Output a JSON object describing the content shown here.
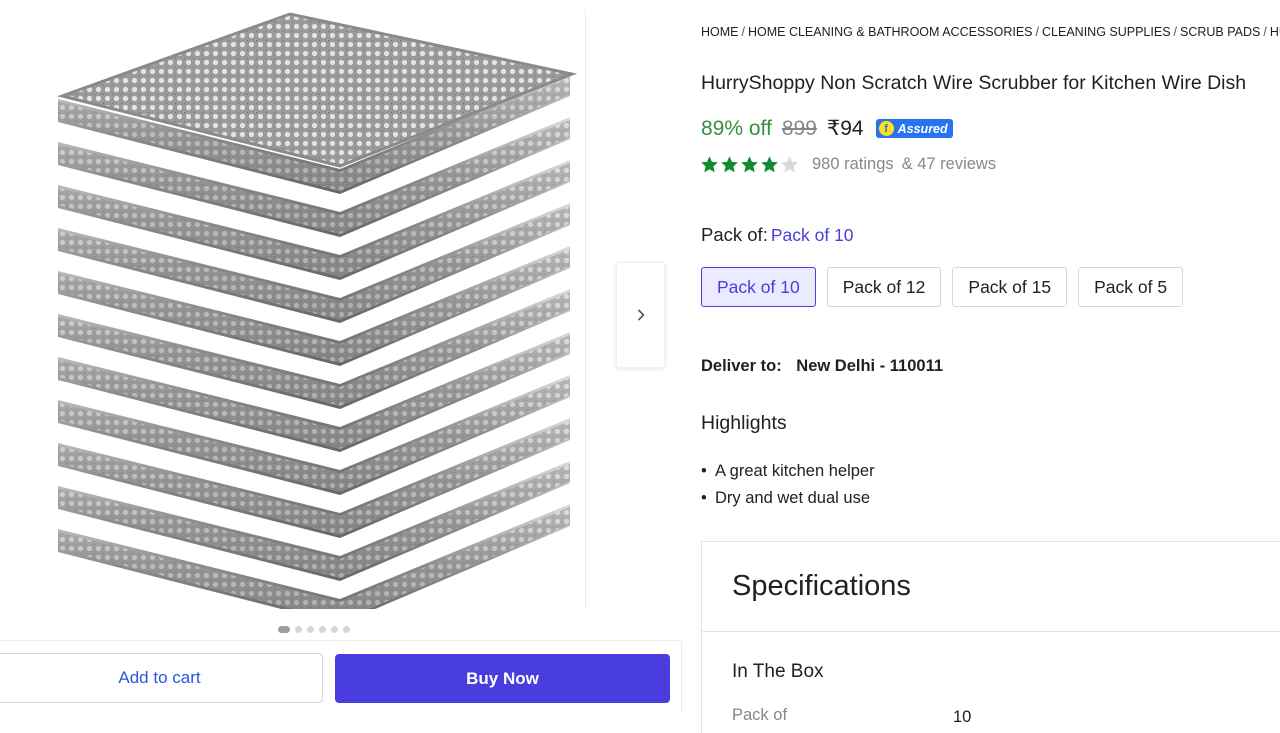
{
  "breadcrumb": [
    "HOME",
    "HOME CLEANING & BATHROOM ACCESSORIES",
    "CLEANING SUPPLIES",
    "SCRUB PADS",
    "HU"
  ],
  "product": {
    "title": "HurryShoppy Non Scratch Wire Scrubber for Kitchen Wire Dish",
    "discount": "89% off",
    "mrp": "899",
    "price": "₹94",
    "assured_label": "Assured",
    "rating_value": 4,
    "ratings_text": "980 ratings",
    "reviews_text": "& 47 reviews"
  },
  "pack": {
    "label": "Pack of:",
    "selected": "Pack of 10",
    "options": [
      "Pack of 10",
      "Pack of 12",
      "Pack of 15",
      "Pack of 5"
    ]
  },
  "delivery": {
    "label": "Deliver to:",
    "location": "New Delhi - 110011"
  },
  "highlights": {
    "title": "Highlights",
    "items": [
      "A great kitchen helper",
      "Dry and wet dual use"
    ]
  },
  "specifications": {
    "title": "Specifications",
    "section": "In The Box",
    "rows": [
      {
        "key": "Pack of",
        "value": "10"
      }
    ]
  },
  "gallery": {
    "image_count": 6,
    "active_index": 0
  },
  "actions": {
    "add_to_cart": "Add to cart",
    "buy_now": "Buy Now"
  },
  "colors": {
    "accent": "#4a3ddf",
    "discount_green": "#388e3c",
    "star_green": "#0f8a2e",
    "assured_blue": "#2874f0"
  },
  "icons": {
    "next": "chevron-right-icon",
    "star": "star-icon",
    "assured": "flipkart-assured-icon"
  }
}
